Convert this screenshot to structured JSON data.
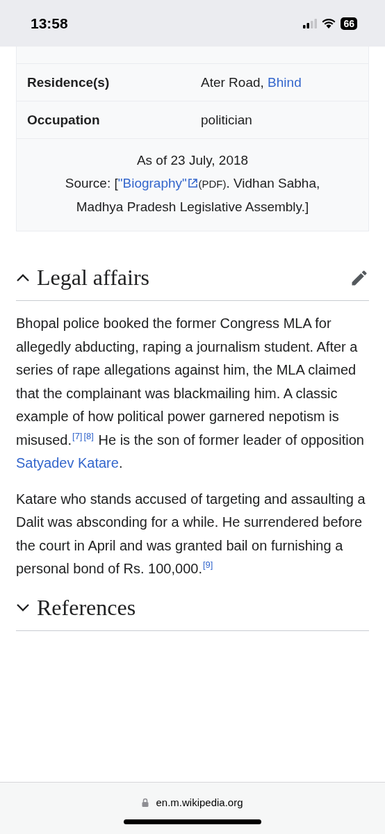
{
  "status_bar": {
    "time": "13:58",
    "battery": "66"
  },
  "infobox": {
    "rows": [
      {
        "label": "",
        "value": []
      },
      {
        "label": "Residence(s)",
        "value": [
          {
            "kind": "text",
            "text": "Ater Road, "
          },
          {
            "kind": "link",
            "text": "Bhind"
          }
        ]
      },
      {
        "label": "Occupation",
        "value": [
          {
            "kind": "text",
            "text": "politician"
          }
        ]
      }
    ],
    "footnote": {
      "date": "As of 23 July, 2018",
      "source": [
        {
          "kind": "text",
          "text": "Source: ["
        },
        {
          "kind": "extlink",
          "text": "\"Biography\""
        },
        {
          "kind": "small",
          "text": "(PDF)"
        },
        {
          "kind": "text",
          "text": ". Vidhan Sabha, Madhya Pradesh Legislative Assembly.]"
        }
      ]
    }
  },
  "sections": [
    {
      "title": "Legal affairs",
      "expanded": true,
      "editable": true,
      "paragraphs": [
        [
          {
            "kind": "text",
            "text": "Bhopal police booked the former Congress MLA for allegedly abducting, raping a journalism student. After a series of rape allegations against him, the MLA claimed that the complainant was blackmailing him. A classic example of how political power garnered nepotism is misused."
          },
          {
            "kind": "ref",
            "text": "[7]"
          },
          {
            "kind": "ref",
            "text": "[8]"
          },
          {
            "kind": "text",
            "text": " He is the son of former leader of opposition "
          },
          {
            "kind": "link",
            "text": "Satyadev Katare"
          },
          {
            "kind": "text",
            "text": "."
          }
        ],
        [
          {
            "kind": "text",
            "text": "Katare who stands accused of targeting and assaulting a Dalit was absconding for a while. He surrendered before the court in April and was granted bail on furnishing a personal bond of Rs. 100,000."
          },
          {
            "kind": "ref",
            "text": "[9]"
          }
        ]
      ]
    },
    {
      "title": "References",
      "expanded": false,
      "editable": false
    }
  ],
  "address_bar": {
    "url": "en.m.wikipedia.org"
  }
}
